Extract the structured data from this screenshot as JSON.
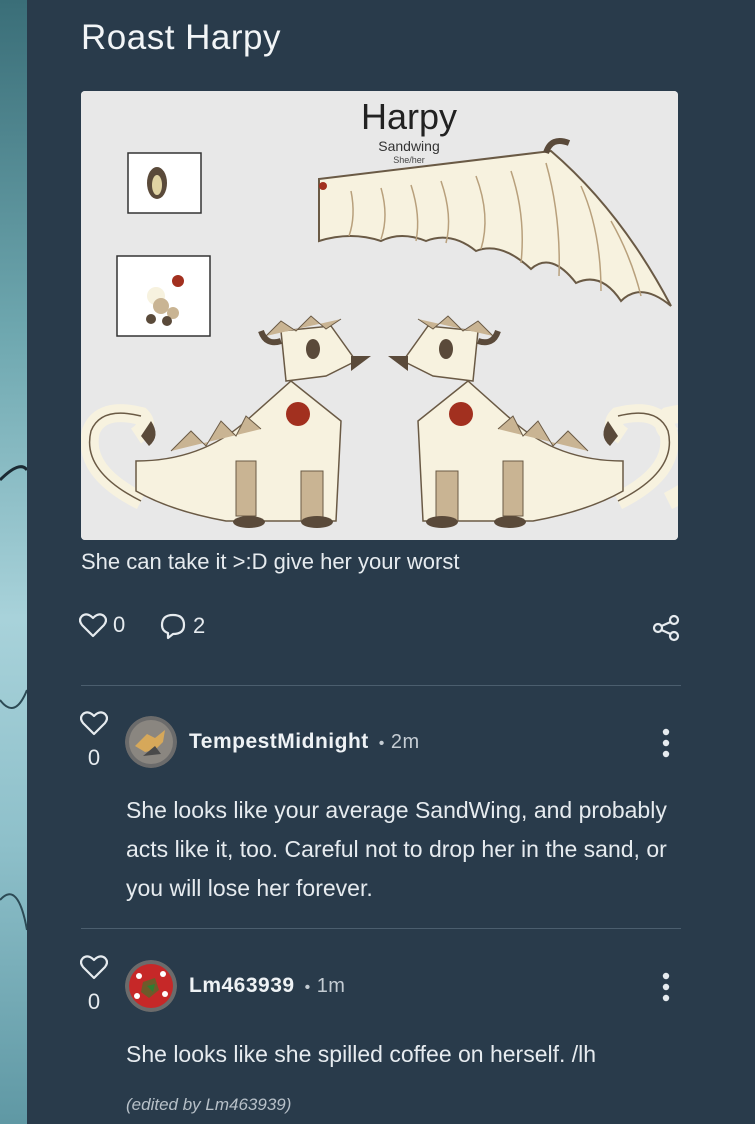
{
  "post": {
    "title": "Roast Harpy",
    "image": {
      "heading": "Harpy",
      "subheading": "Sandwing",
      "pronouns": "She/her",
      "colors": {
        "cream": "#f7f2df",
        "tan": "#c9b493",
        "brown": "#5a4a3a",
        "red": "#a2301f"
      }
    },
    "caption": "She can take it >:D give her your worst",
    "likes": "0",
    "comments_count": "2"
  },
  "comments": [
    {
      "likes": "0",
      "username": "TempestMidnight",
      "time": "2m",
      "text": "She looks like your average SandWing, and probably acts like it, too. Careful not to drop her in the sand, or you will lose her forever."
    },
    {
      "likes": "0",
      "username": "Lm463939",
      "time": "1m",
      "text": "She looks like she spilled coffee on herself. /lh",
      "edited": "(edited by Lm463939)"
    }
  ],
  "icons": {
    "like": "heart-outline-icon",
    "comment": "speech-bubble-icon",
    "share": "share-nodes-icon",
    "more": "vertical-dots-icon"
  },
  "theme": {
    "panel": "#293b4b",
    "text": "#e6ebef",
    "divider": "#4b5e6e"
  }
}
